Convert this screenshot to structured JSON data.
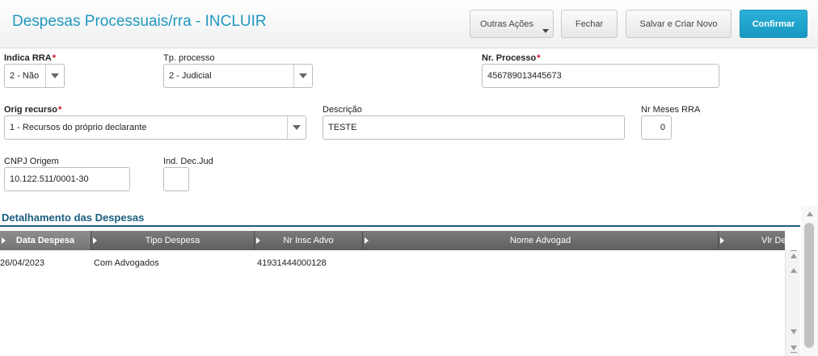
{
  "header": {
    "title": "Despesas Processuais/rra - INCLUIR",
    "buttons": {
      "outras_acoes": "Outras Ações",
      "fechar": "Fechar",
      "salvar_criar": "Salvar e Criar Novo",
      "confirmar": "Confirmar"
    }
  },
  "form": {
    "indica_rra": {
      "label": "Indica RRA",
      "value": "2 - Não",
      "required": "*"
    },
    "tp_processo": {
      "label": "Tp. processo",
      "value": "2 - Judicial"
    },
    "nr_processo": {
      "label": "Nr. Processo",
      "value": "456789013445673",
      "required": "*"
    },
    "orig_recurso": {
      "label": "Orig recurso",
      "value": "1 - Recursos do próprio declarante",
      "required": "*"
    },
    "descricao": {
      "label": "Descrição",
      "value": "TESTE"
    },
    "nr_meses_rra": {
      "label": "Nr Meses RRA",
      "value": "0"
    },
    "cnpj_origem": {
      "label": "CNPJ Origem",
      "value": "10.122.511/0001-30"
    },
    "ind_dec_jud": {
      "label": "Ind. Dec.Jud",
      "value": ""
    }
  },
  "detalhamento": {
    "title": "Detalhamento das Despesas",
    "columns": [
      "Data Despesa",
      "Tipo Despesa",
      "Nr Insc Advo",
      "Nome Advogad",
      "Vlr De"
    ],
    "rows": [
      [
        "26/04/2023",
        "Com Advogados",
        "41931444000128",
        ""
      ]
    ]
  },
  "colors": {
    "accent": "#1f97be",
    "confirm": "#1898c2",
    "section": "#1a5d80",
    "required": "#d0021b",
    "grid_header": "#6a6a6a"
  }
}
